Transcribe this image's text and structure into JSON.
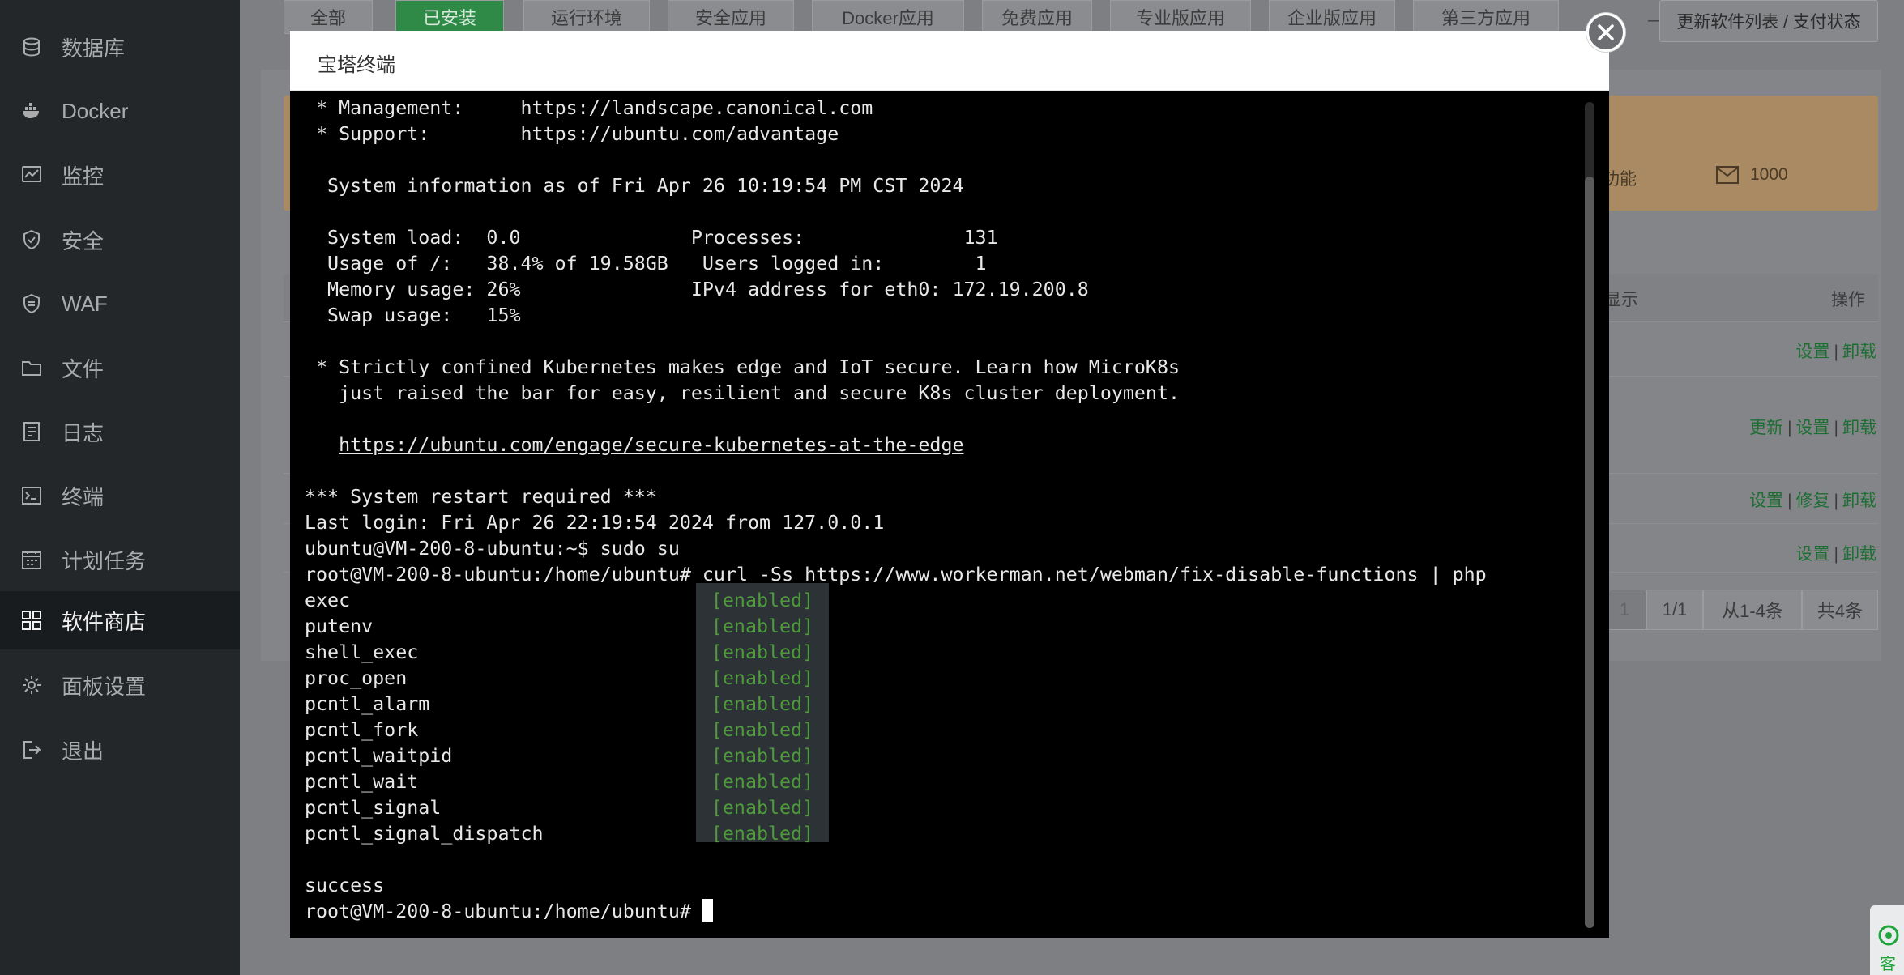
{
  "sidebar": {
    "items": [
      {
        "label": "数据库",
        "icon": "database-icon"
      },
      {
        "label": "Docker",
        "icon": "docker-icon"
      },
      {
        "label": "监控",
        "icon": "monitor-icon"
      },
      {
        "label": "安全",
        "icon": "shield-icon"
      },
      {
        "label": "WAF",
        "icon": "waf-shield-icon"
      },
      {
        "label": "文件",
        "icon": "folder-icon"
      },
      {
        "label": "日志",
        "icon": "log-icon"
      },
      {
        "label": "终端",
        "icon": "terminal-icon"
      },
      {
        "label": "计划任务",
        "icon": "calendar-icon"
      },
      {
        "label": "软件商店",
        "icon": "grid-icon"
      },
      {
        "label": "面板设置",
        "icon": "gear-icon"
      },
      {
        "label": "退出",
        "icon": "logout-icon"
      }
    ],
    "active_index": 9
  },
  "store": {
    "tabs": [
      "全部",
      "已安装",
      "运行环境",
      "安全应用",
      "Docker应用",
      "免费应用",
      "专业版应用",
      "企业版应用",
      "第三方应用"
    ],
    "active_tab": 1,
    "refresh_button": "更新软件列表 / 支付状态",
    "banner_feature_text": "功能",
    "banner_mail_text": "1000",
    "table_header_show": "显示",
    "table_header_ops": "操作",
    "rows": [
      {
        "ops": [
          "设置",
          "卸载"
        ]
      },
      {
        "ops": [
          "更新",
          "设置",
          "卸载"
        ]
      },
      {
        "ops": [
          "设置",
          "修复",
          "卸载"
        ]
      },
      {
        "ops": [
          "设置",
          "卸载"
        ]
      }
    ],
    "pager": {
      "current": "1",
      "pages": "1/1",
      "range": "从1-4条",
      "total": "共4条"
    }
  },
  "support_tab_label": "客",
  "modal": {
    "title": "宝塔终端",
    "close_label": "close"
  },
  "terminal": {
    "lines": [
      " * Management:     https://landscape.canonical.com",
      " * Support:        https://ubuntu.com/advantage",
      "",
      "  System information as of Fri Apr 26 10:19:54 PM CST 2024",
      "",
      "  System load:  0.0               Processes:              131",
      "  Usage of /:   38.4% of 19.58GB   Users logged in:        1",
      "  Memory usage: 26%               IPv4 address for eth0: 172.19.200.8",
      "  Swap usage:   15%",
      "",
      " * Strictly confined Kubernetes makes edge and IoT secure. Learn how MicroK8s",
      "   just raised the bar for easy, resilient and secure K8s cluster deployment.",
      "",
      "   https://ubuntu.com/engage/secure-kubernetes-at-the-edge",
      "",
      "*** System restart required ***",
      "Last login: Fri Apr 26 22:19:54 2024 from 127.0.0.1",
      "ubuntu@VM-200-8-ubuntu:~$ sudo su",
      "root@VM-200-8-ubuntu:/home/ubuntu# curl -Ss https://www.workerman.net/webman/fix-disable-functions | php"
    ],
    "functions": [
      {
        "name": "exec",
        "status": "[enabled]"
      },
      {
        "name": "putenv",
        "status": "[enabled]"
      },
      {
        "name": "shell_exec",
        "status": "[enabled]"
      },
      {
        "name": "proc_open",
        "status": "[enabled]"
      },
      {
        "name": "pcntl_alarm",
        "status": "[enabled]"
      },
      {
        "name": "pcntl_fork",
        "status": "[enabled]"
      },
      {
        "name": "pcntl_waitpid",
        "status": "[enabled]"
      },
      {
        "name": "pcntl_wait",
        "status": "[enabled]"
      },
      {
        "name": "pcntl_signal",
        "status": "[enabled]"
      },
      {
        "name": "pcntl_signal_dispatch",
        "status": "[enabled]"
      }
    ],
    "result": "success",
    "prompt": "root@VM-200-8-ubuntu:/home/ubuntu# "
  },
  "colors": {
    "sidebar_bg": "#23272a",
    "accent_green": "#20a53a",
    "enabled_green": "#4f9a3d",
    "terminal_bg": "#000000"
  }
}
